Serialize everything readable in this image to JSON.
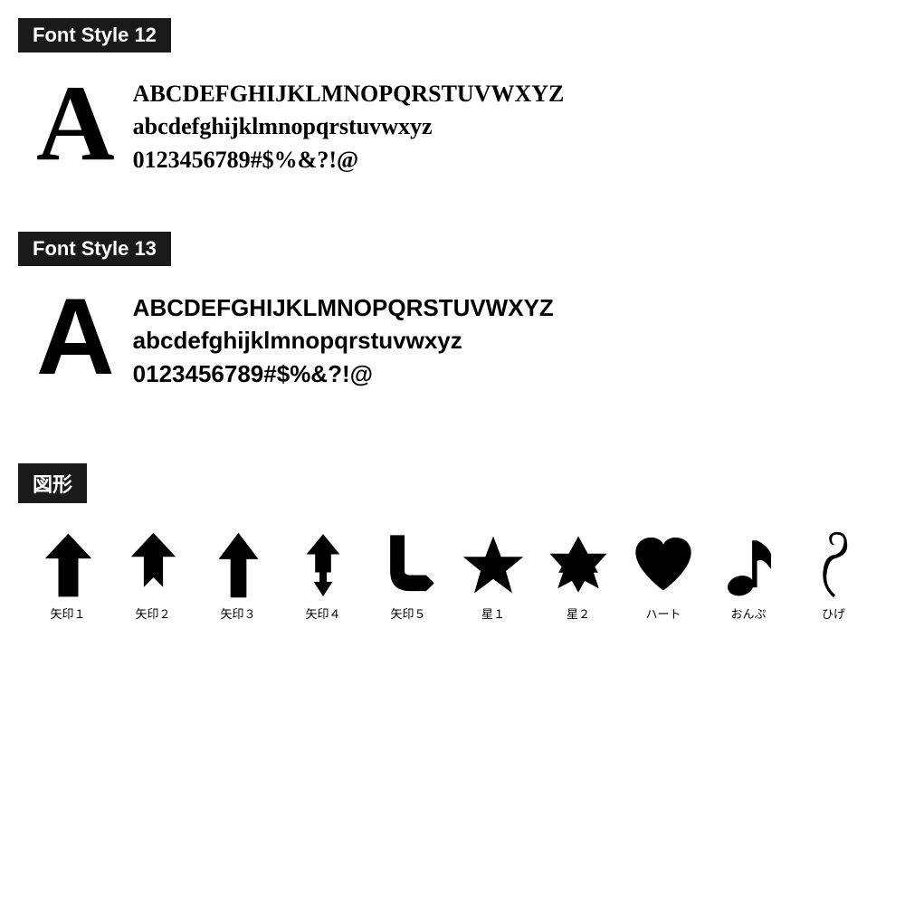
{
  "sections": [
    {
      "id": "font-style-12",
      "label": "Font Style 12",
      "big_letter": "A",
      "lines": [
        "ABCDEFGHIJKLMNOPQRSTUVWXYZ",
        "abcdefghijklmnopqrstuvwxyz",
        "0123456789#$%&?!@"
      ],
      "style_class": "style12"
    },
    {
      "id": "font-style-13",
      "label": "Font Style 13",
      "big_letter": "A",
      "lines": [
        "ABCDEFGHIJKLMNOPQRSTUVWXYZ",
        "abcdefghijklmnopqrstuvwxyz",
        "0123456789#$%&?!@"
      ],
      "style_class": "style13"
    }
  ],
  "shapes_section": {
    "label": "図形",
    "shapes": [
      {
        "id": "yazirushi1",
        "label": "矢印１"
      },
      {
        "id": "yazirushi2",
        "label": "矢印２"
      },
      {
        "id": "yazirushi3",
        "label": "矢印３"
      },
      {
        "id": "yazirushi4",
        "label": "矢印４"
      },
      {
        "id": "yazirushi5",
        "label": "矢印５"
      },
      {
        "id": "hoshi1",
        "label": "星１"
      },
      {
        "id": "hoshi2",
        "label": "星２"
      },
      {
        "id": "heart",
        "label": "ハート"
      },
      {
        "id": "onpu",
        "label": "おんぷ"
      },
      {
        "id": "hige",
        "label": "ひげ"
      }
    ]
  }
}
